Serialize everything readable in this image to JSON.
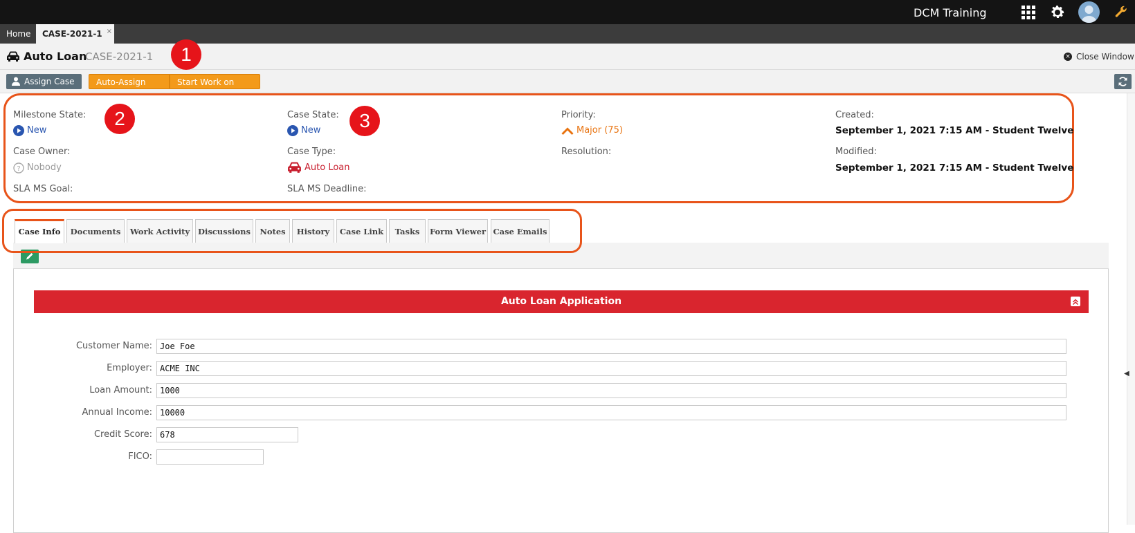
{
  "topbar": {
    "app_title": "DCM Training",
    "icons": [
      "apps-grid-icon",
      "gear-icon",
      "avatar",
      "wrench-icon"
    ]
  },
  "tabs": {
    "home": "Home",
    "case": "CASE-2021-1",
    "close_glyph": "×"
  },
  "header": {
    "title": "Auto Loan",
    "case_id": "CASE-2021-1",
    "close_window": "Close Window"
  },
  "toolbar": {
    "assign": "Assign Case",
    "auto_assign": "Auto-Assign Case",
    "start_work": "Start Work on Case"
  },
  "badges": [
    "1",
    "2",
    "3"
  ],
  "info": {
    "milestone_state_label": "Milestone State:",
    "milestone_state": "New",
    "case_owner_label": "Case Owner:",
    "case_owner": "Nobody",
    "sla_goal_label": "SLA MS Goal:",
    "case_state_label": "Case State:",
    "case_state": "New",
    "case_type_label": "Case Type:",
    "case_type": "Auto Loan",
    "sla_deadline_label": "SLA MS Deadline:",
    "priority_label": "Priority:",
    "priority": "Major (75)",
    "resolution_label": "Resolution:",
    "created_label": "Created:",
    "created": "September 1, 2021 7:15 AM - Student Twelve",
    "modified_label": "Modified:",
    "modified": "September 1, 2021 7:15 AM - Student Twelve"
  },
  "subtabs": [
    "Case Info",
    "Documents",
    "Work Activity",
    "Discussions",
    "Notes",
    "History",
    "Case Link",
    "Tasks",
    "Form Viewer",
    "Case Emails"
  ],
  "form": {
    "section_title": "Auto Loan Application",
    "fields": [
      {
        "label": "Customer Name:",
        "value": "Joe Foe"
      },
      {
        "label": "Employer:",
        "value": "ACME INC"
      },
      {
        "label": "Loan Amount:",
        "value": "1000"
      },
      {
        "label": "Annual Income:",
        "value": "10000"
      },
      {
        "label": "Credit Score:",
        "value": "678"
      },
      {
        "label": "FICO:",
        "value": ""
      }
    ]
  },
  "colors": {
    "accent_orange": "#f39a1a",
    "highlight": "#e8541a",
    "section_red": "#d9252e",
    "link_blue": "#2a56b0"
  }
}
